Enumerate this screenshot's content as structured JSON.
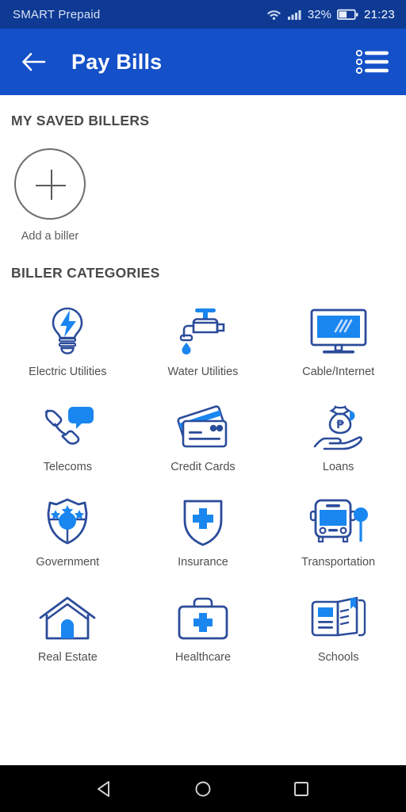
{
  "status_bar": {
    "carrier": "SMART Prepaid",
    "battery_percent": "32%",
    "clock": "21:23",
    "wifi_icon": "wifi-icon",
    "signal_icon": "signal-bars-icon",
    "battery_icon": "battery-icon",
    "background_color": "#0e3a94"
  },
  "app_bar": {
    "title": "Pay Bills",
    "back_icon": "back-arrow-icon",
    "menu_icon": "list-menu-icon",
    "background_color": "#1450c8"
  },
  "saved_billers": {
    "section_title": "MY SAVED BILLERS",
    "add_label": "Add a biller",
    "add_icon": "plus-icon"
  },
  "biller_categories": {
    "section_title": "BILLER CATEGORIES",
    "items": [
      {
        "label": "Electric Utilities",
        "icon": "lightbulb-bolt-icon"
      },
      {
        "label": "Water Utilities",
        "icon": "faucet-droplet-icon"
      },
      {
        "label": "Cable/Internet",
        "icon": "monitor-icon"
      },
      {
        "label": "Telecoms",
        "icon": "phone-chat-icon"
      },
      {
        "label": "Credit Cards",
        "icon": "credit-cards-icon"
      },
      {
        "label": "Loans",
        "icon": "hand-money-bag-icon"
      },
      {
        "label": "Government",
        "icon": "shield-stars-icon"
      },
      {
        "label": "Insurance",
        "icon": "shield-cross-icon"
      },
      {
        "label": "Transportation",
        "icon": "bus-icon"
      },
      {
        "label": "Real Estate",
        "icon": "house-icon"
      },
      {
        "label": "Healthcare",
        "icon": "medical-kit-icon"
      },
      {
        "label": "Schools",
        "icon": "open-book-icon"
      }
    ]
  },
  "navigation_bar": {
    "back_icon": "nav-back-triangle-icon",
    "home_icon": "nav-home-circle-icon",
    "recents_icon": "nav-recents-square-icon"
  },
  "theme": {
    "outline_blue": "#2b4c9b",
    "fill_blue": "#1a86f0",
    "header_blue": "#1450c8",
    "status_blue": "#0e3a94"
  }
}
